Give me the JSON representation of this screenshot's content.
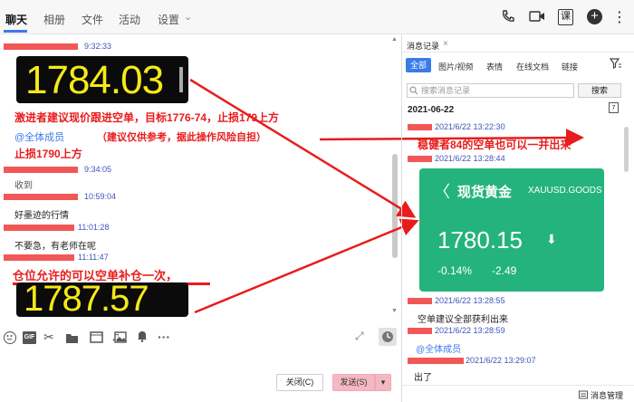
{
  "topbar": {
    "tabs": [
      "聊天",
      "相册",
      "文件",
      "活动",
      "设置"
    ],
    "settings_chevron": "⌄",
    "icons": [
      "phone-icon",
      "video-icon",
      "class-icon",
      "add-icon",
      "more-icon"
    ],
    "class_label": "课"
  },
  "chat": {
    "messages": [
      {
        "time": "9:32:33"
      },
      {
        "ticker": "1784.03"
      },
      {
        "red_text": "激进者建议现价跟进空单，目标1776-74，止损179上方"
      },
      {
        "mention": "@全体成员",
        "note": "（建议仅供参考，据此操作风险自担）"
      },
      {
        "red_text2": "止损1790上方"
      },
      {
        "time": "9:34:05",
        "text": "收到"
      },
      {
        "time": "10:59:04",
        "text": "好墨迹的行情"
      },
      {
        "time": "11:01:28",
        "text": "不要急，有老师在呢"
      },
      {
        "time": "11:11:47"
      },
      {
        "red_text3": "仓位允许的可以空单补仓一次，"
      },
      {
        "ticker2": "1787.57"
      }
    ]
  },
  "toolbar": {
    "icons": [
      "emoji-icon",
      "gif-icon",
      "scissors-icon",
      "folder-icon",
      "music-icon",
      "image-icon",
      "bell-icon",
      "more-icon"
    ],
    "gif_label": "GIF",
    "more_label": "···"
  },
  "footer": {
    "close_label": "关闭(C)",
    "send_label": "发送(S)",
    "send_arrow": "▾"
  },
  "right": {
    "title": "消息记录",
    "close": "×",
    "tabs": [
      "全部",
      "图片/视频",
      "表情",
      "在线文档",
      "链接"
    ],
    "search_placeholder": "搜索消息记录",
    "search_button": "搜索",
    "date": "2021-06-22",
    "calendar_label": "7",
    "entries": [
      {
        "time": "2021/6/22 13:22:30",
        "text": "稳健者84的空单也可以一并出来"
      },
      {
        "time": "2021/6/22 13:28:44"
      },
      {
        "time": "2021/6/22 13:28:55",
        "text": "空单建议全部获利出来"
      },
      {
        "time": "2021/6/22 13:28:59",
        "mention": "@全体成员"
      },
      {
        "time": "2021/6/22 13:29:07",
        "text": "出了"
      }
    ],
    "card": {
      "back": "〈",
      "title": "现货黄金",
      "symbol": "XAUUSD.GOODS",
      "price": "1780.15",
      "arrow": "⬇",
      "change_pct": "-0.14%",
      "change": "-2.49"
    },
    "manager_label": "消息管理"
  },
  "colors": {
    "accent": "#3a7be8",
    "red": "#e81c1c",
    "card_green": "#25b37d",
    "ticker_yellow": "#f5ea18"
  }
}
